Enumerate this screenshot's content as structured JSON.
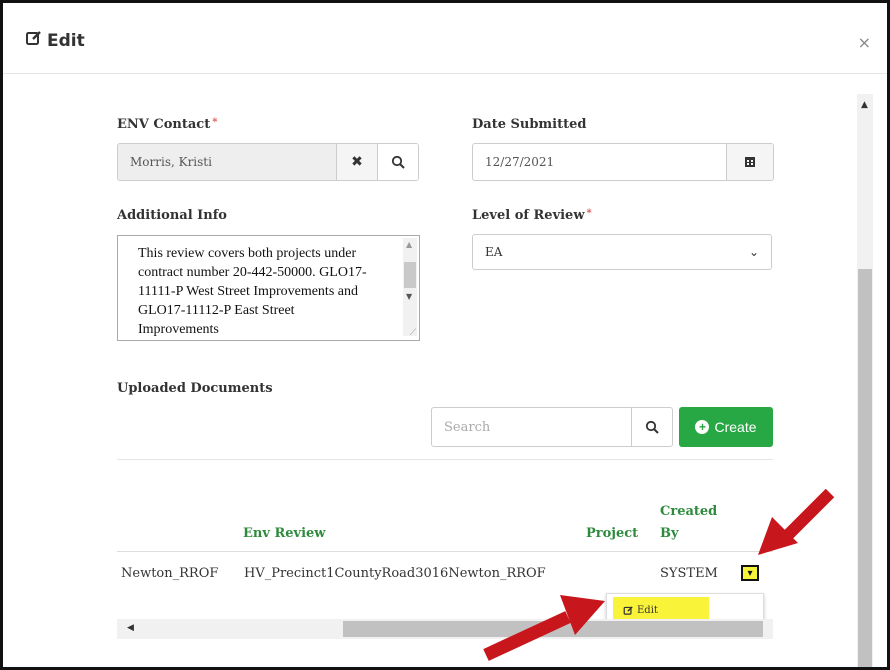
{
  "modal": {
    "title": "Edit",
    "close": "×"
  },
  "form": {
    "env_contact_label": "ENV Contact",
    "required_mark": "*",
    "env_contact_value": "Morris, Kristi",
    "date_submitted_label": "Date Submitted",
    "date_submitted_value": "12/27/2021",
    "additional_info_label": "Additional Info",
    "additional_info_value": "This review covers both projects under contract number 20-442-50000. GLO17-11111-P West Street Improvements and GLO17-11112-P East Street Improvements",
    "level_of_review_label": "Level of Review",
    "level_of_review_value": "EA"
  },
  "documents": {
    "section_label": "Uploaded Documents",
    "search_placeholder": "Search",
    "create_label": "Create",
    "columns": [
      "Env Review",
      "Project",
      "Created",
      "By"
    ],
    "rows": [
      {
        "name": "Newton_RROF",
        "env_review": "HV_Precinct1CountyRoad3016Newton_RROF",
        "project": "",
        "created_by": "SYSTEM"
      }
    ],
    "row_menu": {
      "edit_label": "Edit"
    }
  },
  "colors": {
    "accent_green": "#28a745",
    "header_green": "#2e8b3d",
    "highlight_yellow": "#f9f33a",
    "annotation_red": "#c8161d"
  }
}
